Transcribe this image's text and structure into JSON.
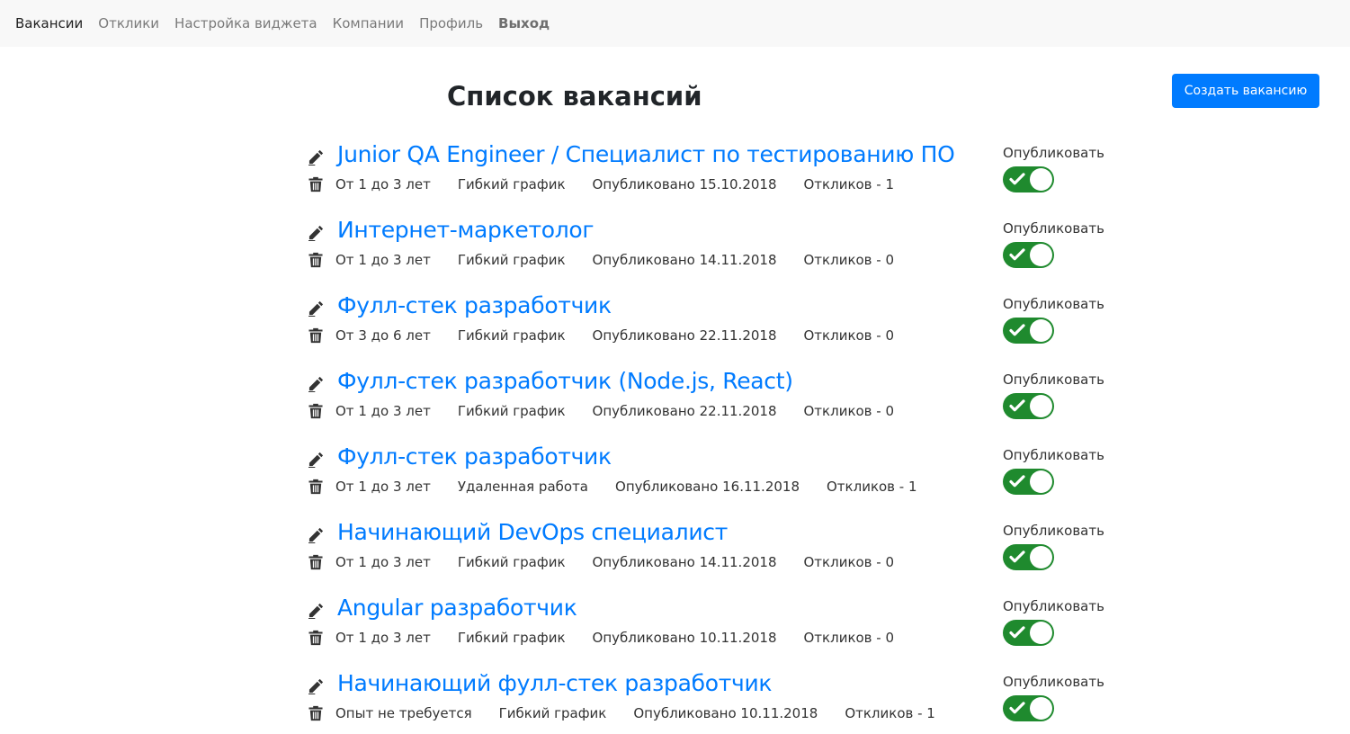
{
  "nav": {
    "items": [
      {
        "label": "Вакансии",
        "active": true
      },
      {
        "label": "Отклики",
        "active": false
      },
      {
        "label": "Настройка виджета",
        "active": false
      },
      {
        "label": "Компании",
        "active": false
      },
      {
        "label": "Профиль",
        "active": false
      },
      {
        "label": "Выход",
        "active": false
      }
    ]
  },
  "header": {
    "title": "Список вакансий",
    "create_button": "Создать вакансию"
  },
  "icons": {
    "edit": "pencil-icon",
    "delete": "trash-icon",
    "toggle_on": "check-icon"
  },
  "colors": {
    "link": "#007bff",
    "toggle_on": "#1f8a2e",
    "nav_bg": "#f8f8f8"
  },
  "vacancies": [
    {
      "title": "Junior QA Engineer / Специалист по тестированию ПО",
      "experience": "От 1 до 3 лет",
      "schedule": "Гибкий график",
      "published": "Опубликовано 15.10.2018",
      "responses": "Откликов - 1",
      "publish_label": "Опубликовать",
      "published_on": true
    },
    {
      "title": "Интернет-маркетолог",
      "experience": "От 1 до 3 лет",
      "schedule": "Гибкий график",
      "published": "Опубликовано 14.11.2018",
      "responses": "Откликов - 0",
      "publish_label": "Опубликовать",
      "published_on": true
    },
    {
      "title": "Фулл-стек разработчик",
      "experience": "От 3 до 6 лет",
      "schedule": "Гибкий график",
      "published": "Опубликовано 22.11.2018",
      "responses": "Откликов - 0",
      "publish_label": "Опубликовать",
      "published_on": true
    },
    {
      "title": "Фулл-стек разработчик (Node.js, React)",
      "experience": "От 1 до 3 лет",
      "schedule": "Гибкий график",
      "published": "Опубликовано 22.11.2018",
      "responses": "Откликов - 0",
      "publish_label": "Опубликовать",
      "published_on": true
    },
    {
      "title": "Фулл-стек разработчик",
      "experience": "От 1 до 3 лет",
      "schedule": "Удаленная работа",
      "published": "Опубликовано 16.11.2018",
      "responses": "Откликов - 1",
      "publish_label": "Опубликовать",
      "published_on": true
    },
    {
      "title": "Начинающий DevOps специалист",
      "experience": "От 1 до 3 лет",
      "schedule": "Гибкий график",
      "published": "Опубликовано 14.11.2018",
      "responses": "Откликов - 0",
      "publish_label": "Опубликовать",
      "published_on": true
    },
    {
      "title": "Angular разработчик",
      "experience": "От 1 до 3 лет",
      "schedule": "Гибкий график",
      "published": "Опубликовано 10.11.2018",
      "responses": "Откликов - 0",
      "publish_label": "Опубликовать",
      "published_on": true
    },
    {
      "title": "Начинающий фулл-стек разработчик",
      "experience": "Опыт не требуется",
      "schedule": "Гибкий график",
      "published": "Опубликовано 10.11.2018",
      "responses": "Откликов - 1",
      "publish_label": "Опубликовать",
      "published_on": true
    }
  ]
}
